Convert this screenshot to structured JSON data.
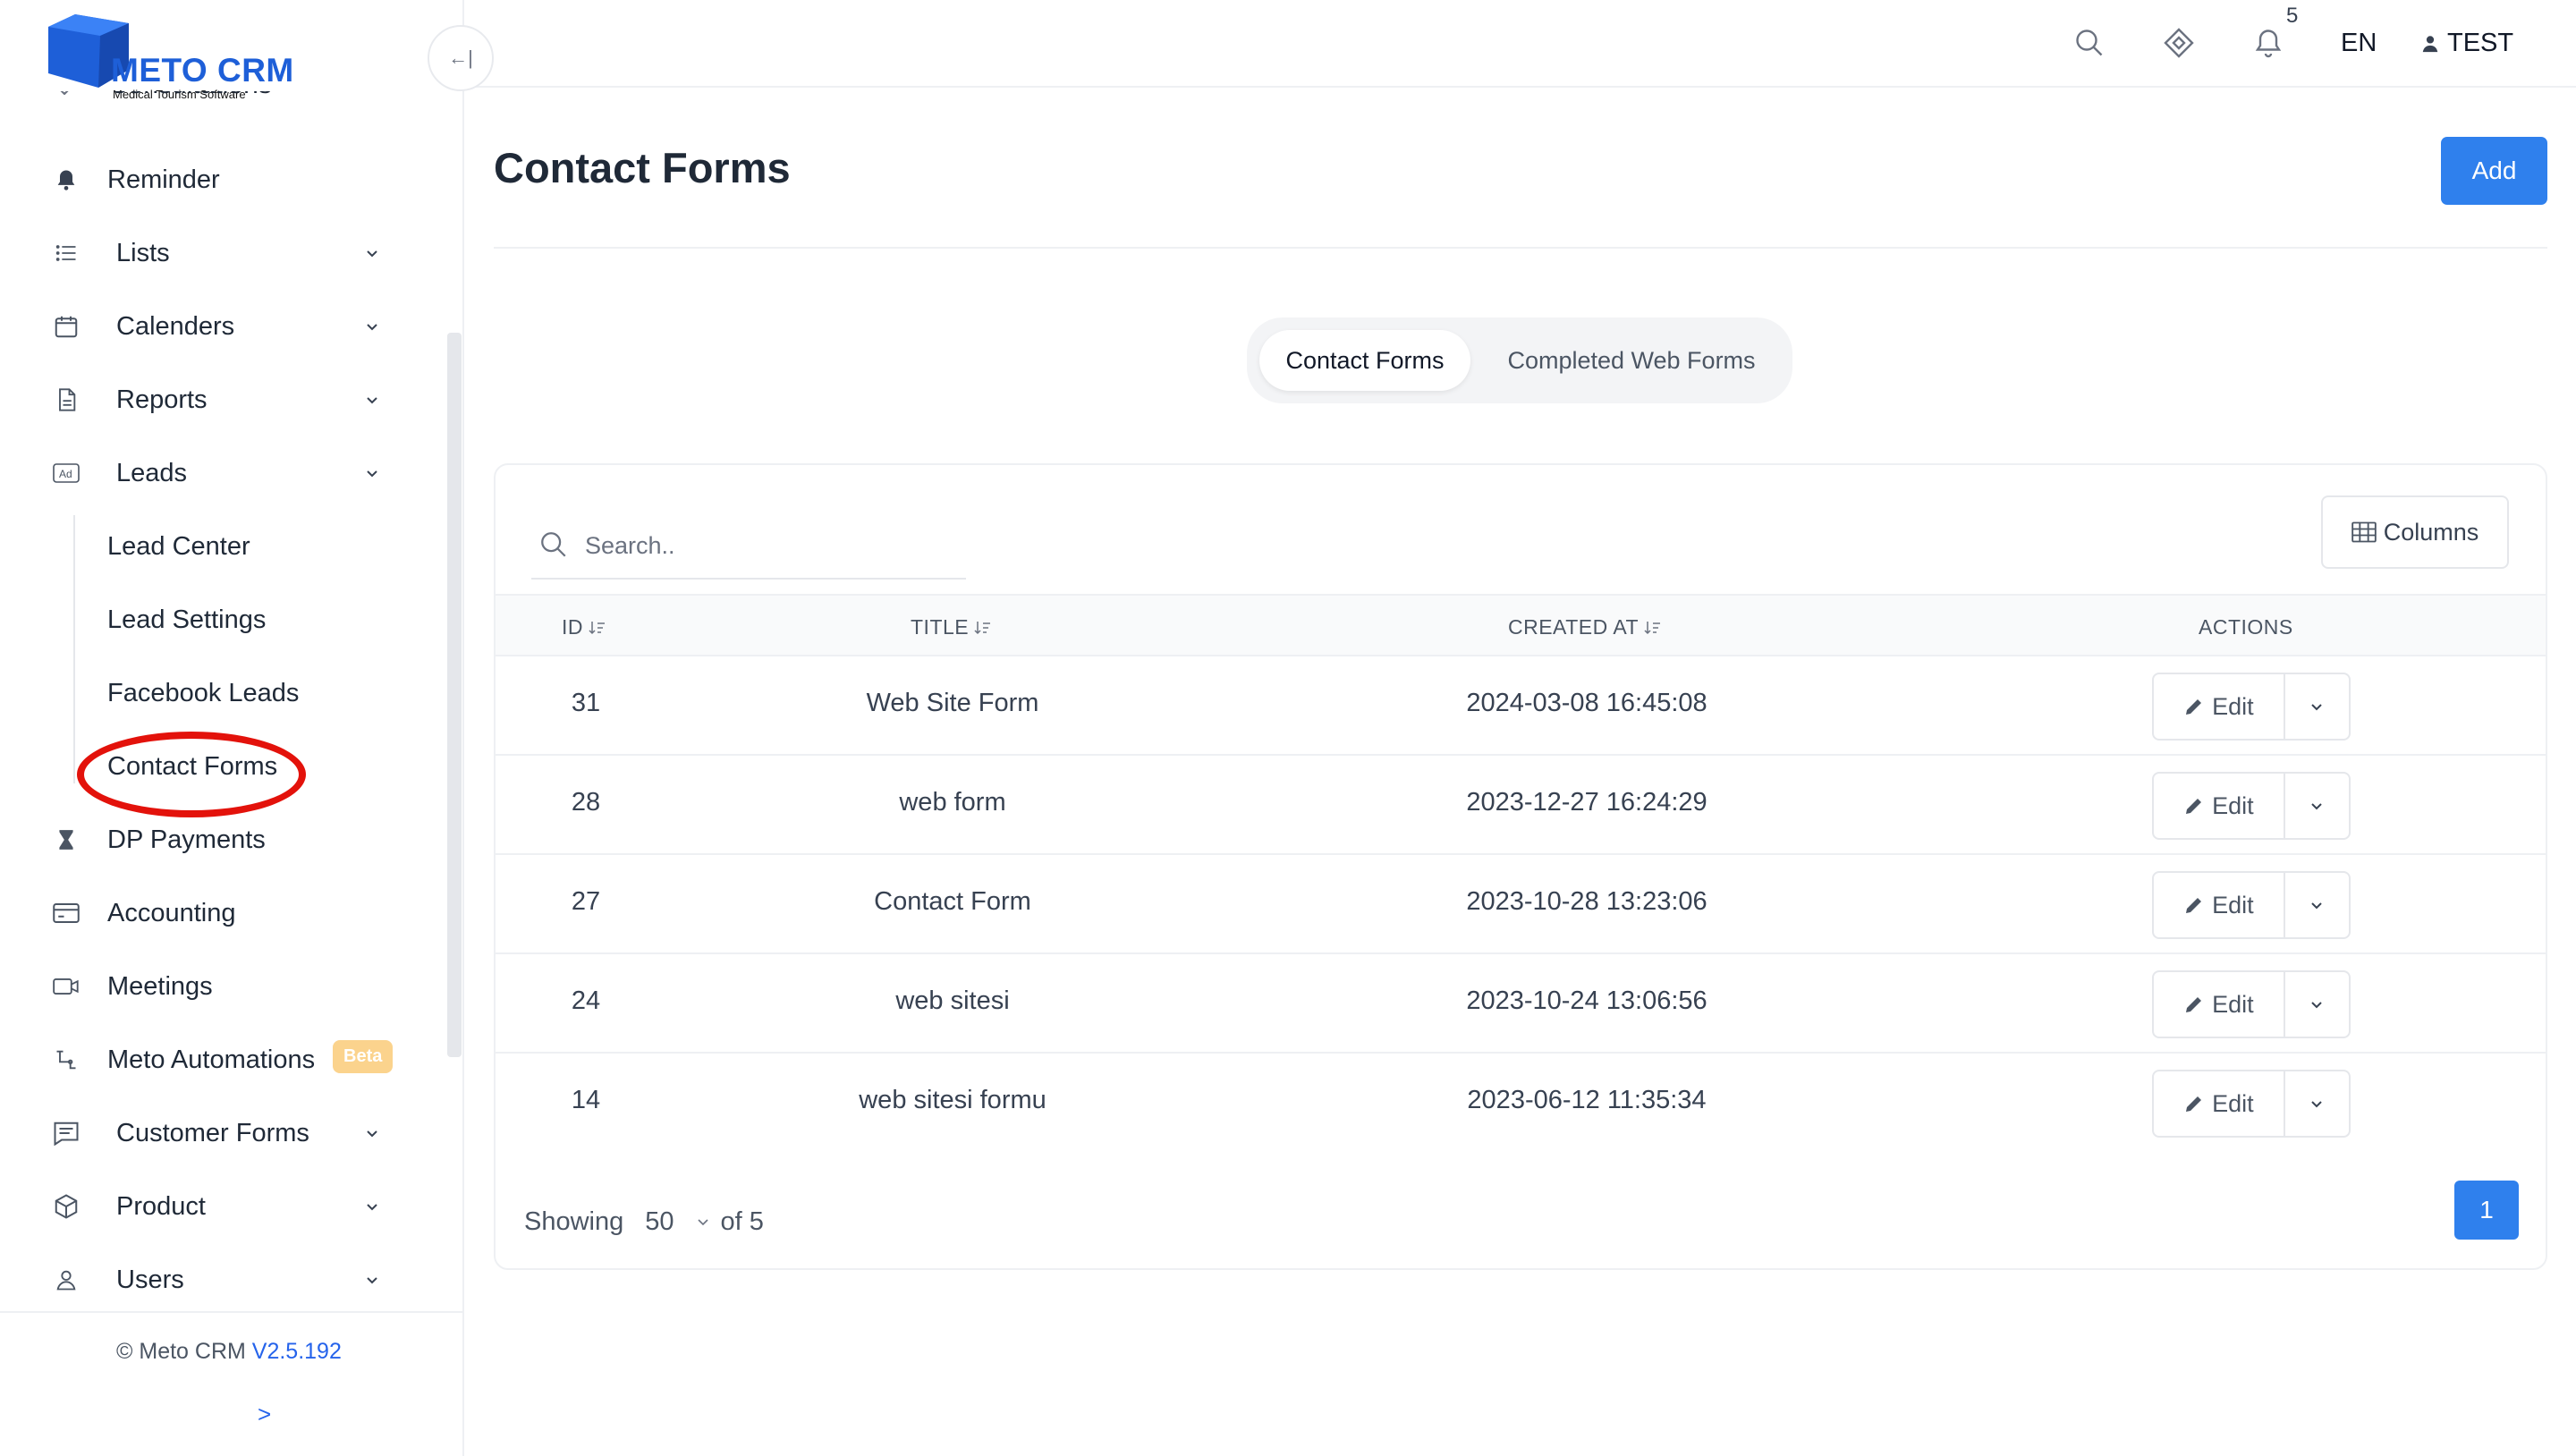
{
  "app": {
    "brand": "METO CRM",
    "tagline": "Medical Tourism Software",
    "brand_color": "#1e5fd8"
  },
  "sidebar": {
    "cut_item_label": "Consultations",
    "items": [
      {
        "label": "Reminder",
        "icon": "bell-icon"
      },
      {
        "label": "Lists",
        "icon": "list-icon"
      },
      {
        "label": "Calenders",
        "icon": "calendar-icon"
      },
      {
        "label": "Reports",
        "icon": "document-icon"
      },
      {
        "label": "Leads",
        "icon": "ad-icon"
      },
      {
        "label": "Lead Center"
      },
      {
        "label": "Lead Settings"
      },
      {
        "label": "Facebook Leads"
      },
      {
        "label": "Contact Forms"
      },
      {
        "label": "DP Payments",
        "icon": "hourglass-icon"
      },
      {
        "label": "Accounting",
        "icon": "credit-card-icon"
      },
      {
        "label": "Meetings",
        "icon": "video-icon"
      },
      {
        "label": "Meto Automations",
        "icon": "flow-icon",
        "badge": "Beta"
      },
      {
        "label": "Customer Forms",
        "icon": "form-icon"
      },
      {
        "label": "Product",
        "icon": "box-icon"
      },
      {
        "label": "Users",
        "icon": "user-icon"
      }
    ],
    "copyright": "© Meto CRM",
    "version": "V2.5.192",
    "expand_symbol": ">"
  },
  "topbar": {
    "notification_count": "5",
    "language": "EN",
    "user_name": "TEST",
    "collapse_symbol": "←|"
  },
  "page": {
    "title": "Contact Forms",
    "add_label": "Add",
    "tabs": [
      "Contact Forms",
      "Completed Web Forms"
    ],
    "active_tab": "Contact Forms"
  },
  "table": {
    "search_placeholder": "Search..",
    "columns_label": "Columns",
    "headers": [
      "ID",
      "TITLE",
      "CREATED AT",
      "ACTIONS"
    ],
    "rows": [
      {
        "id": "31",
        "title": "Web Site Form",
        "created_at": "2024-03-08 16:45:08"
      },
      {
        "id": "28",
        "title": "web form",
        "created_at": "2023-12-27 16:24:29"
      },
      {
        "id": "27",
        "title": "Contact Form",
        "created_at": "2023-10-28 13:23:06"
      },
      {
        "id": "24",
        "title": "web sitesi",
        "created_at": "2023-10-24 13:06:56"
      },
      {
        "id": "14",
        "title": "web sitesi formu",
        "created_at": "2023-06-12 11:35:34"
      }
    ],
    "edit_label": "Edit",
    "showing_label": "Showing",
    "per_page": "50",
    "of_label": "of 5",
    "current_page": "1"
  },
  "colors": {
    "primary": "#2f80ed",
    "highlight": "#e3120b",
    "beta_badge": "#fbd38d"
  }
}
